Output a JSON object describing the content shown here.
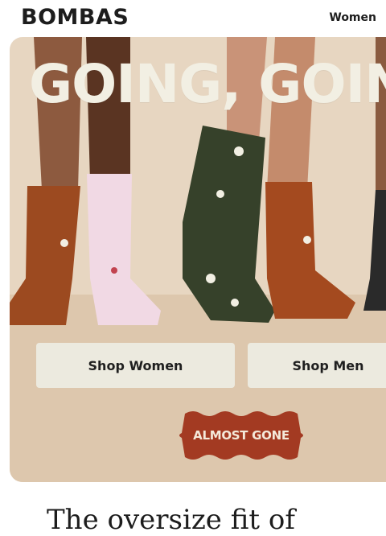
{
  "header": {
    "logo": "BOMBAS",
    "nav_women": "Women"
  },
  "hero": {
    "headline": "GOING, GOING",
    "buttons": {
      "shop_women": "Shop Women",
      "shop_men": "Shop Men"
    },
    "badge": "ALMOST GONE"
  },
  "below": {
    "text": "The oversize fit of"
  },
  "colors": {
    "hero_bg": "#e7d6c1",
    "badge": "#a33a22",
    "button_bg": "#eceadf"
  },
  "icons": [
    "sock-illustration"
  ]
}
